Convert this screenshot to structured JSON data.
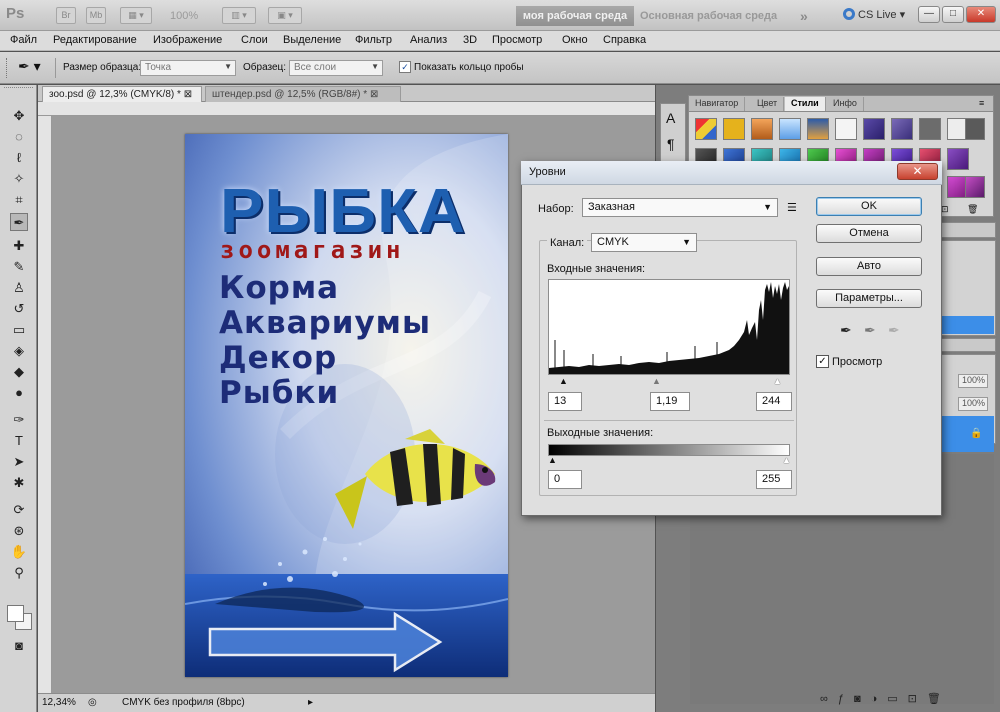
{
  "appbar": {
    "logo": "Ps",
    "btn_br": "Br",
    "btn_mb": "Mb",
    "zoom": "100%",
    "workspace_active": "моя рабочая среда",
    "workspace_main": "Основная рабочая среда",
    "cslive": "CS Live"
  },
  "menu": [
    "Файл",
    "Редактирование",
    "Изображение",
    "Слои",
    "Выделение",
    "Фильтр",
    "Анализ",
    "3D",
    "Просмотр",
    "Окно",
    "Справка"
  ],
  "options": {
    "sample_size_label": "Размер образца:",
    "sample_size_value": "Точка",
    "sample_label": "Образец:",
    "sample_value": "Все слои",
    "show_ring_label": "Показать кольцо пробы"
  },
  "tabs": [
    {
      "label": "зоо.psd @ 12,3% (CMYK/8) *"
    },
    {
      "label": "штендер.psd @ 12,5% (RGB/8#) *"
    }
  ],
  "poster": {
    "title": "РЫБКА",
    "subtitle": "зоомагазин",
    "items": [
      "Корма",
      "Аквариумы",
      "Декор",
      "Рыбки"
    ]
  },
  "status": {
    "zoom": "12,34%",
    "profile": "CMYK без профиля (8bpc)"
  },
  "panels": {
    "tabs": [
      "Навигатор",
      "Цвет",
      "Стили",
      "Инфо"
    ],
    "active_tab": "Стили",
    "pct1": "100%",
    "pct2": "100%"
  },
  "dialog": {
    "title": "Уровни",
    "preset_label": "Набор:",
    "preset_value": "Заказная",
    "channel_label": "Канал:",
    "channel_value": "CMYK",
    "input_label": "Входные значения:",
    "input_black": "13",
    "input_gamma": "1,19",
    "input_white": "244",
    "output_label": "Выходные значения:",
    "output_black": "0",
    "output_white": "255",
    "btn_ok": "OK",
    "btn_cancel": "Отмена",
    "btn_auto": "Авто",
    "btn_options": "Параметры...",
    "preview_label": "Просмотр",
    "preview_checked": true
  },
  "colors": {
    "accent_blue": "#3c8ee8",
    "dialog_bg": "#dfdfdf",
    "close_red": "#c7422f"
  }
}
